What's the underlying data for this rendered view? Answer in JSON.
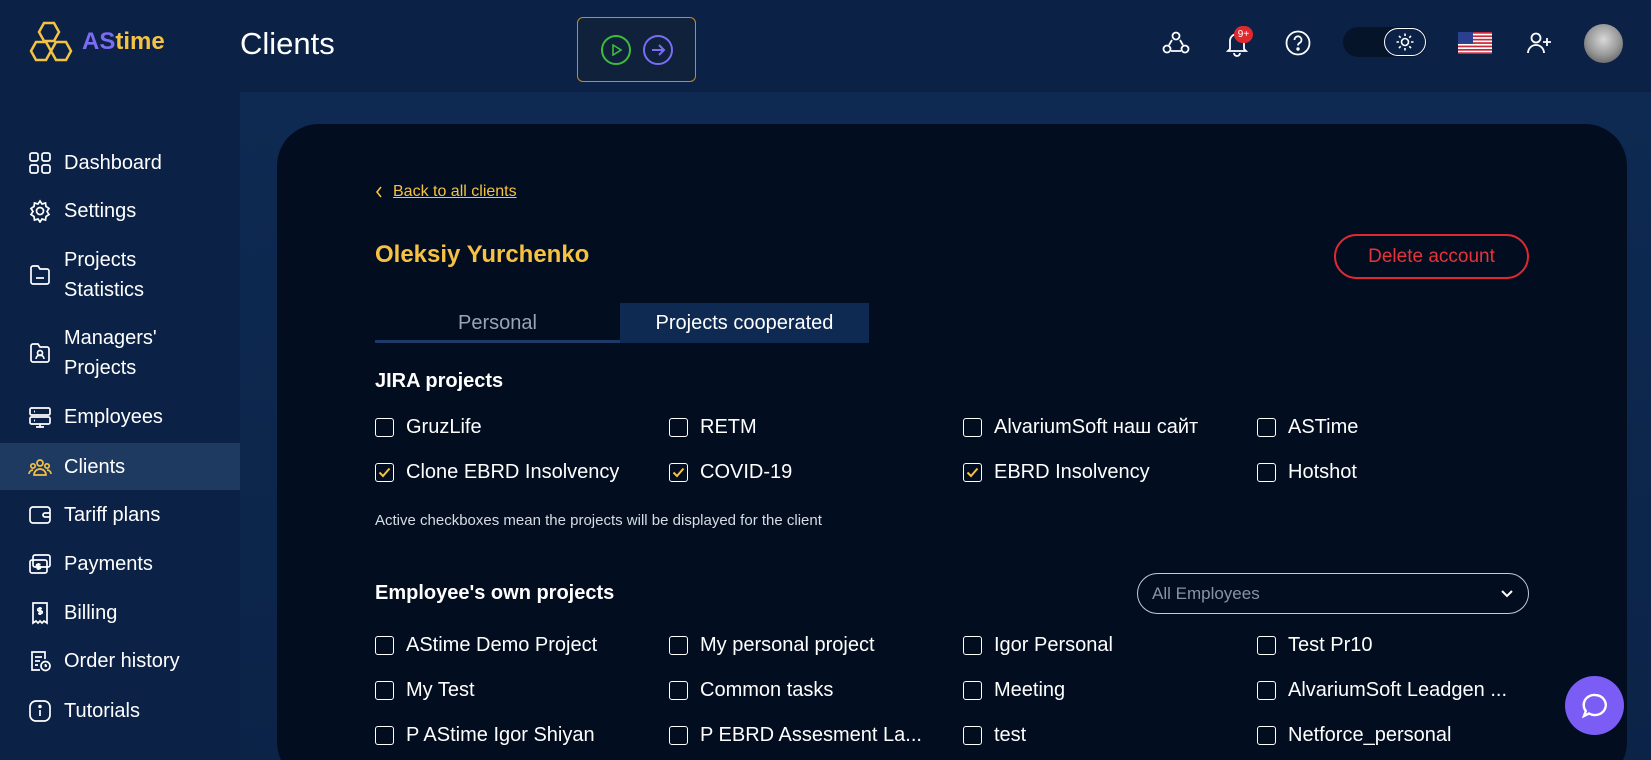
{
  "header": {
    "logo_as": "AS",
    "logo_time": "time",
    "page_title": "Clients",
    "notifications_badge": "9+",
    "icons": [
      "team-icon",
      "bell-icon",
      "help-icon",
      "sun-icon",
      "us-flag-icon",
      "add-user-icon"
    ]
  },
  "sidebar": {
    "items": [
      {
        "label": "Dashboard",
        "icon": "dashboard-icon"
      },
      {
        "label": "Settings",
        "icon": "gear-icon"
      },
      {
        "label": "Projects",
        "label2": "Statistics",
        "icon": "folder-icon"
      },
      {
        "label": "Managers'",
        "label2": "Projects",
        "icon": "manager-icon"
      },
      {
        "label": "Employees",
        "icon": "server-icon"
      },
      {
        "label": "Clients",
        "icon": "clients-icon",
        "active": true
      },
      {
        "label": "Tariff plans",
        "icon": "wallet-icon"
      },
      {
        "label": "Payments",
        "icon": "payments-icon"
      },
      {
        "label": "Billing",
        "icon": "billing-icon"
      },
      {
        "label": "Order history",
        "icon": "order-history-icon"
      },
      {
        "label": "Tutorials",
        "icon": "info-icon"
      }
    ]
  },
  "main": {
    "back_label": "Back to all clients",
    "client_name": "Oleksiy Yurchenko",
    "delete_label": "Delete account",
    "tabs": [
      {
        "label": "Personal",
        "active": false
      },
      {
        "label": "Projects cooperated",
        "active": true
      }
    ],
    "jira": {
      "title": "JIRA projects",
      "items": [
        {
          "label": "GruzLife",
          "checked": false
        },
        {
          "label": "RETM",
          "checked": false
        },
        {
          "label": "AlvariumSoft наш сайт",
          "checked": false
        },
        {
          "label": "ASTime",
          "checked": false
        },
        {
          "label": "Clone EBRD Insolvency",
          "checked": true
        },
        {
          "label": "COVID-19",
          "checked": true
        },
        {
          "label": "EBRD Insolvency",
          "checked": true
        },
        {
          "label": "Hotshot",
          "checked": false
        }
      ],
      "hint": "Active checkboxes mean the projects will be displayed for the client"
    },
    "own": {
      "title": "Employee's own projects",
      "select_placeholder": "All Employees",
      "items": [
        {
          "label": "AStime Demo Project",
          "checked": false
        },
        {
          "label": "My personal project",
          "checked": false
        },
        {
          "label": "Igor Personal",
          "checked": false
        },
        {
          "label": "Test Pr10",
          "checked": false
        },
        {
          "label": "My Test",
          "checked": false
        },
        {
          "label": "Common tasks",
          "checked": false
        },
        {
          "label": "Meeting",
          "checked": false
        },
        {
          "label": "AlvariumSoft Leadgen ...",
          "checked": false
        },
        {
          "label": "P AStime Igor Shiyan",
          "checked": false
        },
        {
          "label": "P EBRD Assesment La...",
          "checked": false
        },
        {
          "label": "test",
          "checked": false
        },
        {
          "label": "Netforce_personal",
          "checked": false
        }
      ]
    }
  },
  "colors": {
    "accent_yellow": "#f5c243",
    "accent_purple": "#7c6cf2",
    "danger": "#e0282f",
    "sidebar_bg": "#0b2246",
    "card_bg": "#020d1f"
  }
}
